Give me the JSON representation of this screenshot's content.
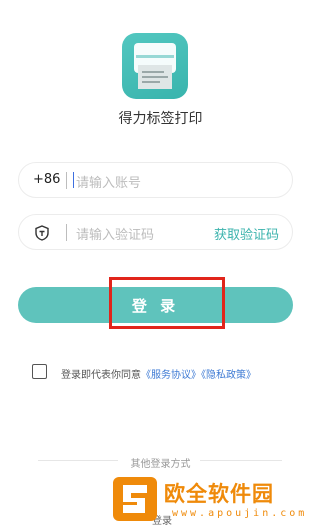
{
  "app": {
    "name": "得力标签打印",
    "icon": "label-printer-icon"
  },
  "phone": {
    "country_code": "+86",
    "placeholder": "请输入账号"
  },
  "code": {
    "placeholder": "请输入验证码",
    "get_code_label": "获取验证码"
  },
  "login": {
    "label": "登 录"
  },
  "agreement": {
    "prefix": "登录即代表你同意",
    "service_link": "《服务协议》",
    "privacy_link": "《隐私政策》"
  },
  "other_login": {
    "label": "其他登录方式",
    "partial_text": "登录"
  },
  "watermark": {
    "title": "欧全软件园",
    "url": "www.apoujin.com"
  },
  "colors": {
    "accent": "#5fc3bc",
    "link": "#3f7bd4",
    "highlight": "#e1251b",
    "watermark": "#ef8a0a"
  }
}
